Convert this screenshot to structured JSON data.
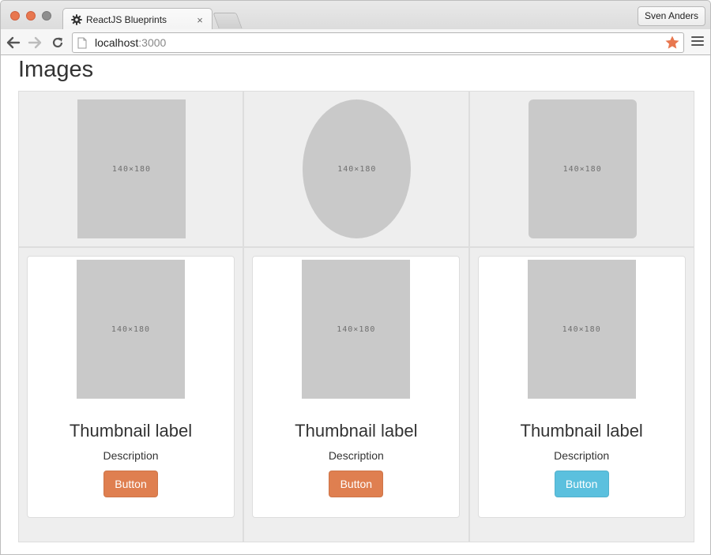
{
  "browser": {
    "tab_title": "ReactJS Blueprints",
    "tab_close": "×",
    "profile_name": "Sven Anders",
    "url_host": "localhost",
    "url_port": ":3000",
    "star_color": "#e8774f"
  },
  "page": {
    "title": "Images",
    "image_row": [
      {
        "placeholder": "140×180",
        "shape": "rectangle"
      },
      {
        "placeholder": "140×180",
        "shape": "circle"
      },
      {
        "placeholder": "140×180",
        "shape": "rounded"
      }
    ],
    "thumbnails": [
      {
        "placeholder": "140×180",
        "label": "Thumbnail label",
        "description": "Description",
        "button": "Button",
        "button_style": "primary"
      },
      {
        "placeholder": "140×180",
        "label": "Thumbnail label",
        "description": "Description",
        "button": "Button",
        "button_style": "primary"
      },
      {
        "placeholder": "140×180",
        "label": "Thumbnail label",
        "description": "Description",
        "button": "Button",
        "button_style": "info"
      }
    ]
  },
  "colors": {
    "primary_button": "#df7f50",
    "info_button": "#5bc0de",
    "placeholder": "#c9c9c9"
  }
}
